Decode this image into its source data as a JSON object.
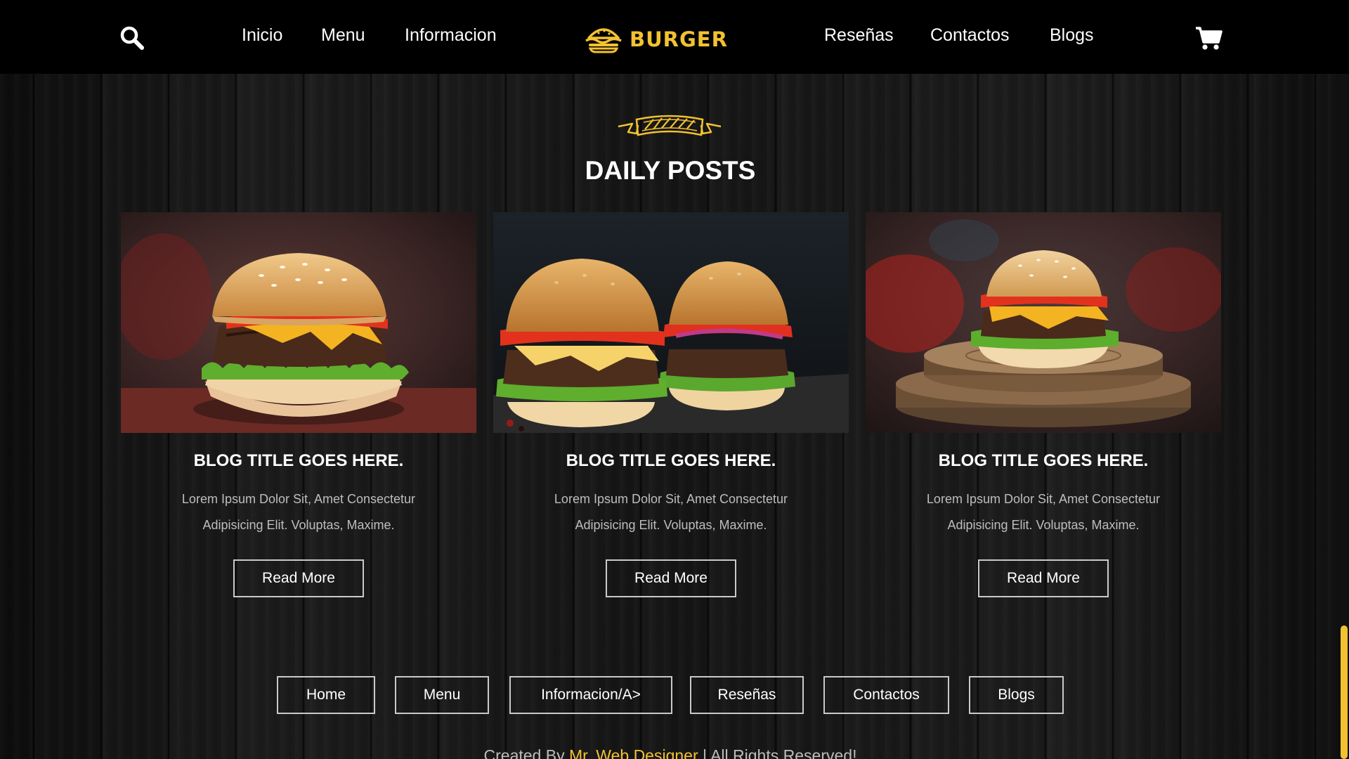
{
  "header": {
    "nav_left": [
      "Inicio",
      "Menu",
      "Informacion"
    ],
    "logo_text": "BURGER",
    "nav_right": [
      "Reseñas",
      "Contactos",
      "Blogs"
    ],
    "search_icon": "search-icon",
    "cart_icon": "cart-icon"
  },
  "section": {
    "title": "DAILY POSTS",
    "ribbon_icon": "ribbon-icon"
  },
  "posts": [
    {
      "image": "burger-photo-single",
      "title": "BLOG TITLE GOES HERE.",
      "text_line1": "Lorem Ipsum Dolor Sit, Amet Consectetur",
      "text_line2": "Adipisicing Elit. Voluptas, Maxime.",
      "button": "Read More"
    },
    {
      "image": "burger-photo-double",
      "title": "BLOG TITLE GOES HERE.",
      "text_line1": "Lorem Ipsum Dolor Sit, Amet Consectetur",
      "text_line2": "Adipisicing Elit. Voluptas, Maxime.",
      "button": "Read More"
    },
    {
      "image": "burger-photo-board",
      "title": "BLOG TITLE GOES HERE.",
      "text_line1": "Lorem Ipsum Dolor Sit, Amet Consectetur",
      "text_line2": "Adipisicing Elit. Voluptas, Maxime.",
      "button": "Read More"
    }
  ],
  "footer": {
    "links": [
      "Home",
      "Menu",
      "Informacion/A>",
      "Reseñas",
      "Contactos",
      "Blogs"
    ],
    "credit_prefix": "Created By",
    "credit_author": "Mr. Web Designer",
    "credit_suffix": "| All Rights Reserved!"
  },
  "colors": {
    "accent": "#f2c230",
    "header_bg": "#000000",
    "page_bg": "#141414"
  }
}
